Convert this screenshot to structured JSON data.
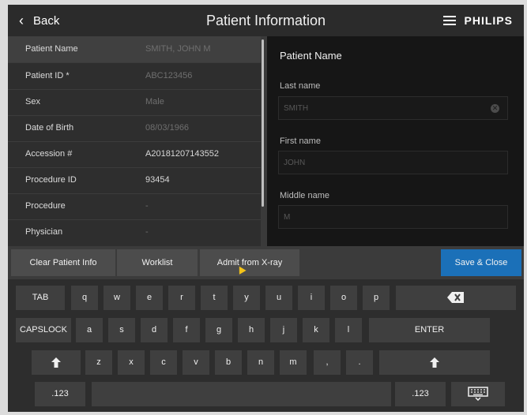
{
  "header": {
    "back_label": "Back",
    "back_icon": "chevron-left-icon",
    "title": "Patient Information",
    "menu_icon": "hamburger-menu-icon",
    "brand": "PHILIPS"
  },
  "patient_fields": [
    {
      "label": "Patient Name",
      "value": "SMITH, JOHN M"
    },
    {
      "label": "Patient ID *",
      "value": "ABC123456"
    },
    {
      "label": "Sex",
      "value": "Male"
    },
    {
      "label": "Date of Birth",
      "value": "08/03/1966"
    },
    {
      "label": "Accession #",
      "value": "A20181207143552"
    },
    {
      "label": "Procedure ID",
      "value": "93454"
    },
    {
      "label": "Procedure",
      "value": "-"
    },
    {
      "label": "Physician",
      "value": "-"
    }
  ],
  "form": {
    "title": "Patient Name",
    "last_name_label": "Last name",
    "last_name_value": "SMITH",
    "first_name_label": "First name",
    "first_name_value": "JOHN",
    "middle_name_label": "Middle name",
    "middle_name_value": "M"
  },
  "actions": {
    "clear": "Clear Patient Info",
    "worklist": "Worklist",
    "admit": "Admit from X-ray",
    "save": "Save & Close"
  },
  "keyboard": {
    "row1": [
      "TAB",
      "q",
      "w",
      "e",
      "r",
      "t",
      "y",
      "u",
      "i",
      "o",
      "p"
    ],
    "row2": [
      "CAPSLOCK",
      "a",
      "s",
      "d",
      "f",
      "g",
      "h",
      "j",
      "k",
      "l",
      "ENTER"
    ],
    "row3": [
      "z",
      "x",
      "c",
      "v",
      "b",
      "n",
      "m",
      ",",
      "."
    ],
    "numbers_label": ".123"
  },
  "colors": {
    "primary": "#1b70b8",
    "pointer": "#f3c319"
  }
}
